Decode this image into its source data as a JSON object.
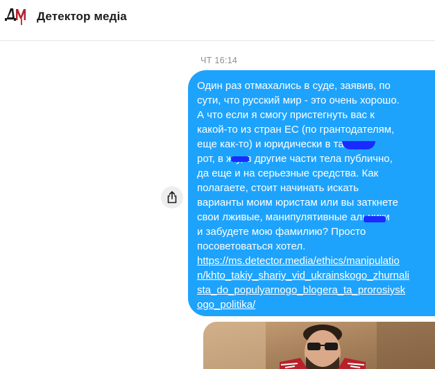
{
  "header": {
    "title": "Детектор медіа",
    "logo_icon": "detector-media-logo-icon"
  },
  "chat": {
    "timestamp": "ЧТ 16:14",
    "share_icon": "share-icon",
    "message_lines": [
      "Один раз отмахались в суде, заявив, по",
      "сути, что русский мир - это очень хорошо.",
      "А что если я смогу пристегнуть вас к",
      "какой-то из стран ЕС (по грантодателям,",
      "еще как-то) и юридически в          там в",
      "рот, в ж      у, в другие части тела публично,",
      "да еще и на серьезные средства. Как",
      "полагаете, стоит начинать искать",
      "варианты моим юристам или вы заткнете",
      "свои лживые, манипулятивные        альники",
      "и забудете мою фамилию? Просто",
      "посоветоваться хотел."
    ],
    "link_lines": [
      "https://ms.detector.media/ethics/manipulatio",
      "n/khto_takiy_shariy_vid_ukrainskogo_zhurnali",
      "sta_do_populyarnogo_blogera_ta_prorosiysk",
      "ogo_politika/"
    ]
  },
  "colors": {
    "bubble": "#1ea3fd",
    "redaction": "#1a2bff",
    "logo_red": "#b3242f",
    "logo_dark": "#1b1b1b"
  }
}
